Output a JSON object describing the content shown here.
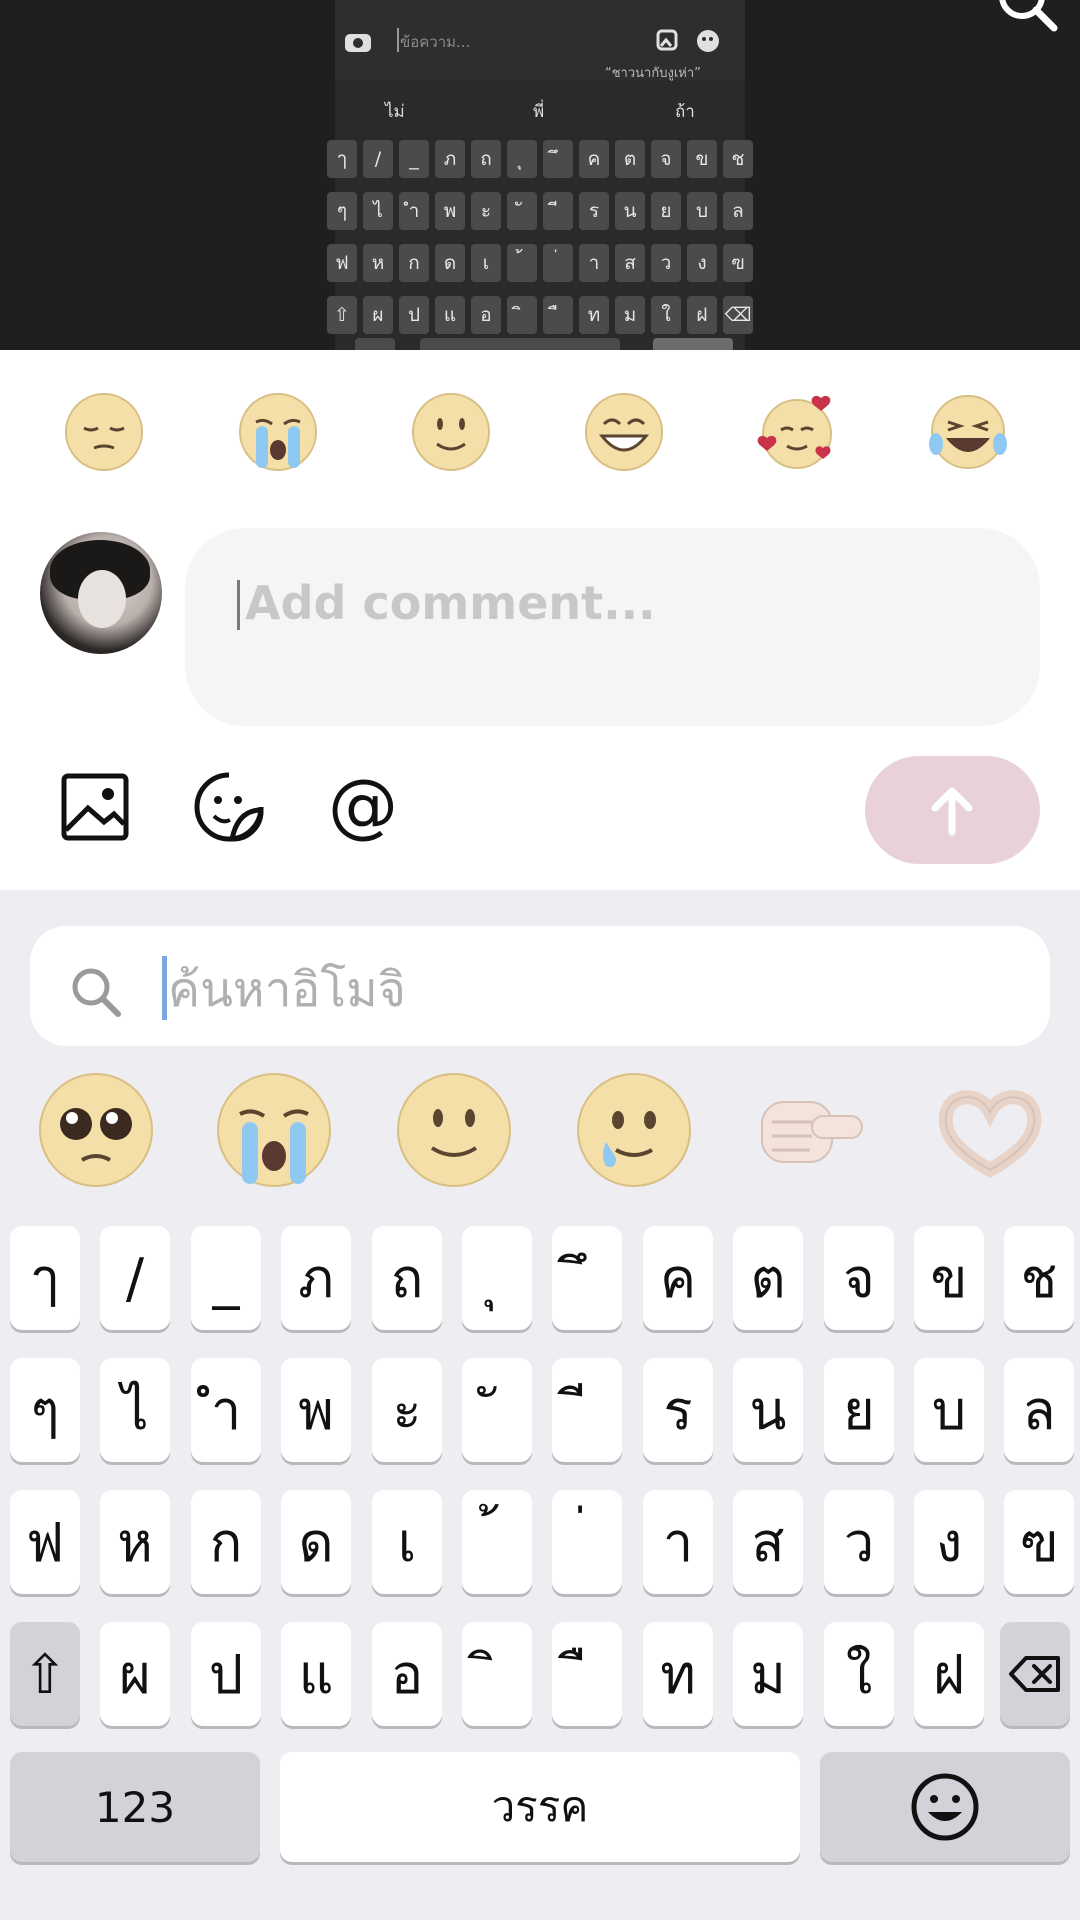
{
  "video": {
    "mini_keyboard": {
      "input_placeholder": "ข้อความ...",
      "sticker_caption": "“ชาวนากับงูเห่า”",
      "suggestions": [
        "ไม่",
        "พี่",
        "ถ้า"
      ],
      "rows": [
        [
          "ๅ",
          "/",
          "_",
          "ภ",
          "ถ",
          "ุ",
          "ึ",
          "ค",
          "ต",
          "จ",
          "ข",
          "ช"
        ],
        [
          "ๆ",
          "ไ",
          "ำ",
          "พ",
          "ะ",
          "ั",
          "ี",
          "ร",
          "น",
          "ย",
          "บ",
          "ล"
        ],
        [
          "ฟ",
          "ห",
          "ก",
          "ด",
          "เ",
          "้",
          "่",
          "า",
          "ส",
          "ว",
          "ง",
          "ฃ"
        ],
        [
          "⇧",
          "ผ",
          "ป",
          "แ",
          "อ",
          "ิ",
          "ื",
          "ท",
          "ม",
          "ใ",
          "ฝ",
          "⌫"
        ]
      ]
    }
  },
  "quick_emojis": [
    "pensive",
    "loudly-crying",
    "slightly-smiling",
    "grinning",
    "smiling-hearts",
    "tears-of-joy"
  ],
  "comment": {
    "placeholder": "Add comment..."
  },
  "toolbar_icons": [
    "image-icon",
    "sticker-icon",
    "mention-icon"
  ],
  "toolbar_mention_glyph": "@",
  "emoji_search": {
    "placeholder": "ค้นหาอิโมจิ"
  },
  "suggested_emojis": [
    "pleading",
    "loudly-crying",
    "slightly-smiling",
    "holding-back-tears",
    "pointing-at-viewer",
    "heart-hands"
  ],
  "keyboard": {
    "rows": [
      [
        "ๅ",
        "/",
        "_",
        "ภ",
        "ถ",
        "ุ",
        "ึ",
        "ค",
        "ต",
        "จ",
        "ข",
        "ช"
      ],
      [
        "ๆ",
        "ไ",
        "ำ",
        "พ",
        "ะ",
        "ั",
        "ี",
        "ร",
        "น",
        "ย",
        "บ",
        "ล"
      ],
      [
        "ฟ",
        "ห",
        "ก",
        "ด",
        "เ",
        "้",
        "่",
        "า",
        "ส",
        "ว",
        "ง",
        "ฃ"
      ],
      [
        "ผ",
        "ป",
        "แ",
        "อ",
        "ิ",
        "ื",
        "ท",
        "ม",
        "ใ",
        "ฝ"
      ]
    ],
    "shift": "⇧",
    "numbers_label": "123",
    "space_label": "วรรค",
    "emoji_key_icon": "smiley-icon"
  }
}
